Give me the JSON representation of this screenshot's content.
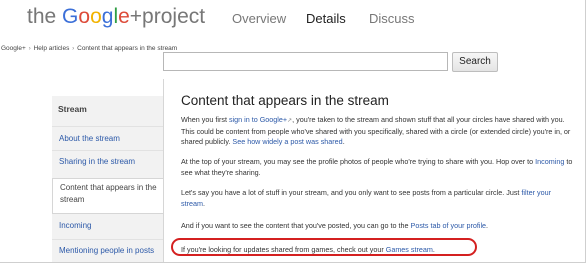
{
  "header": {
    "logo": {
      "prefix": "the ",
      "g1": "G",
      "o1": "o",
      "o2": "o",
      "g2": "g",
      "l": "l",
      "e": "e",
      "suffix": "+project"
    },
    "nav": [
      {
        "label": "Overview",
        "active": false
      },
      {
        "label": "Details",
        "active": true
      },
      {
        "label": "Discuss",
        "active": false
      }
    ]
  },
  "breadcrumb": [
    "Google+",
    "Help articles",
    "Content that appears in the stream"
  ],
  "breadcrumb_sep": "›",
  "search": {
    "value": "",
    "button_label": "Search"
  },
  "sidebar": {
    "title": "Stream",
    "items": [
      {
        "label": "About the stream",
        "selected": false
      },
      {
        "label": "Sharing in the stream",
        "selected": false
      },
      {
        "label": "Content that appears in the stream",
        "selected": true
      },
      {
        "label": "Incoming",
        "selected": false
      },
      {
        "label": "Mentioning people in posts",
        "selected": false
      }
    ]
  },
  "content": {
    "title": "Content that appears in the stream",
    "p0": {
      "t1": "When you first ",
      "link1": "sign in to Google+",
      "t2": ", you're taken to the stream and shown stuff that all your circles have shared with you. This could be content from people who've shared with you specifically, shared with a circle (or extended circle) you're in, or shared publicly. ",
      "link2": "See how widely a post was shared",
      "t3": "."
    },
    "p1": {
      "t1": "At the top of your stream, you may see the profile photos of people who're trying to share with you. Hop over to ",
      "link1": "Incoming",
      "t2": " to see what they're sharing."
    },
    "p2": {
      "t1": "Let's say you have a lot of stuff in your stream, and you only want to see posts from a particular circle. Just ",
      "link1": "filter your stream",
      "t2": "."
    },
    "p3": {
      "t1": "And if you want to see the content that you've posted, you can go to the ",
      "link1": "Posts tab of your profile",
      "t2": "."
    },
    "p4": {
      "t1": "If you're looking for updates shared from games, check out your ",
      "link1": "Games stream",
      "t2": "."
    }
  },
  "colors": {
    "link": "#2c59a8",
    "highlight": "#d42020",
    "sidebar_bg": "#f2f2f2"
  },
  "icons": {
    "external": "external-link-icon"
  }
}
